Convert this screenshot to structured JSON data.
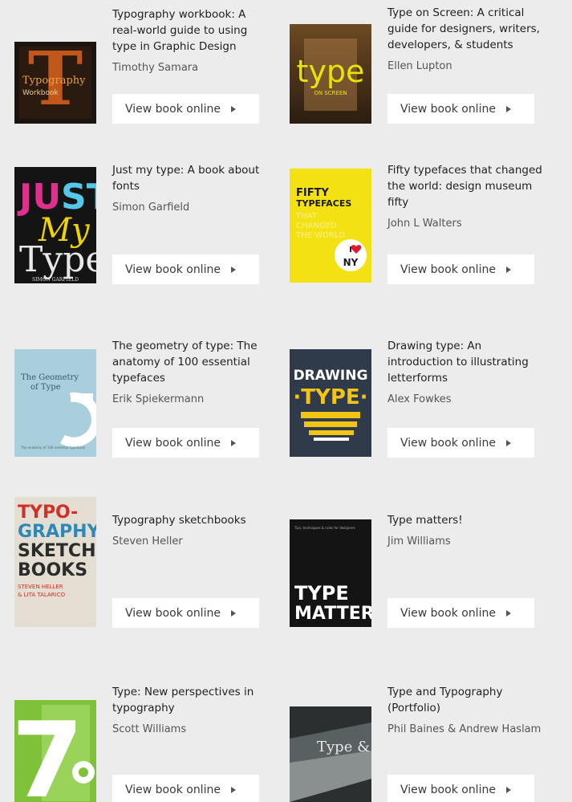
{
  "button_label": "View book online",
  "books": [
    {
      "title": "Typography workbook: A real-world guide to using type in Graphic Design",
      "author": "Timothy Samara",
      "cover_icon": "typography-workbook-cover",
      "cover_text": "Typography Workbook"
    },
    {
      "title": "Type on Screen: A critical guide for designers, writers, developers, & students",
      "author": "Ellen Lupton",
      "cover_icon": "type-on-screen-cover",
      "cover_text": "type"
    },
    {
      "title": "Just my type: A book about fonts",
      "author": "Simon Garfield",
      "cover_icon": "just-my-type-cover",
      "cover_text": "JUST MY Type"
    },
    {
      "title": "Fifty typefaces that changed the world: design museum fifty",
      "author": "John L Walters",
      "cover_icon": "fifty-typefaces-cover",
      "cover_text": "FIFTY TYPEFACES"
    },
    {
      "title": "The geometry of type: The anatomy of 100 essential typefaces",
      "author": "Erik Spiekermann",
      "cover_icon": "geometry-of-type-cover",
      "cover_text": "The Geometry of Type"
    },
    {
      "title": "Drawing type: An introduction to illustrating letterforms",
      "author": "Alex Fowkes",
      "cover_icon": "drawing-type-cover",
      "cover_text": "DRAWING TYPE"
    },
    {
      "title": "Typography sketchbooks",
      "author": "Steven Heller",
      "cover_icon": "typography-sketchbooks-cover",
      "cover_text": "TYPO-GRAPHY SKETCH-BOOKS"
    },
    {
      "title": "Type matters!",
      "author": "Jim Williams",
      "cover_icon": "type-matters-cover",
      "cover_text": "TYPE MATTERS"
    },
    {
      "title": "Type: New perspectives in typography",
      "author": "Scott Williams",
      "cover_icon": "type-new-perspectives-cover",
      "cover_text": "7"
    },
    {
      "title": "Type and Typography (Portfolio)",
      "author": "Phil Baines & Andrew Haslam",
      "cover_icon": "type-and-typography-cover",
      "cover_text": "Type &"
    }
  ]
}
